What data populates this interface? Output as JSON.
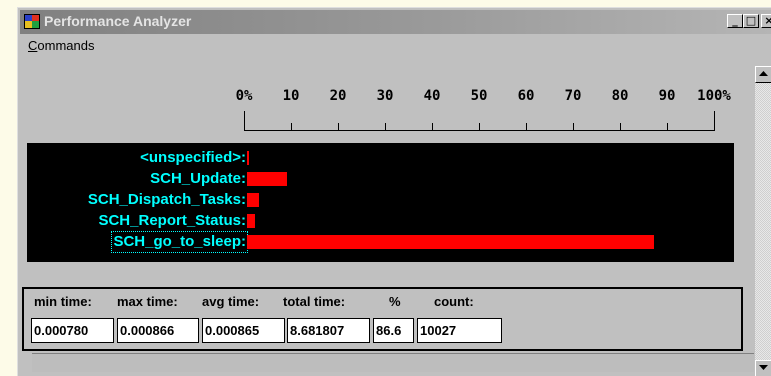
{
  "window": {
    "title": "Performance Analyzer",
    "controls": {
      "minimize": "_",
      "maximize": "□",
      "close": "×"
    }
  },
  "menu": {
    "commands": {
      "accel": "C",
      "rest": "ommands"
    }
  },
  "scale": {
    "labels": [
      "0%",
      "10",
      "20",
      "30",
      "40",
      "50",
      "60",
      "70",
      "80",
      "90",
      "100%"
    ]
  },
  "bars": [
    {
      "label": "<unspecified>:",
      "percent": 0.3
    },
    {
      "label": "SCH_Update:",
      "percent": 8.6
    },
    {
      "label": "SCH_Dispatch_Tasks:",
      "percent": 2.6
    },
    {
      "label": "SCH_Report_Status:",
      "percent": 1.7
    },
    {
      "label": "SCH_go_to_sleep:",
      "percent": 86.6,
      "selected": true
    }
  ],
  "bar_color": "#ff0000",
  "label_color": "#00ffff",
  "stats": {
    "headers": {
      "min": "min time:",
      "max": "max time:",
      "avg": "avg time:",
      "total": "total time:",
      "pct": "%",
      "count": "count:"
    },
    "values": {
      "min": "0.000780",
      "max": "0.000866",
      "avg": "0.000865",
      "total": "8.681807",
      "pct": "86.6",
      "count": "10027"
    }
  },
  "icons": {
    "app": "performance-analyzer-app-icon",
    "scroll_up": "arrow-up-icon",
    "scroll_down": "arrow-down-icon"
  }
}
